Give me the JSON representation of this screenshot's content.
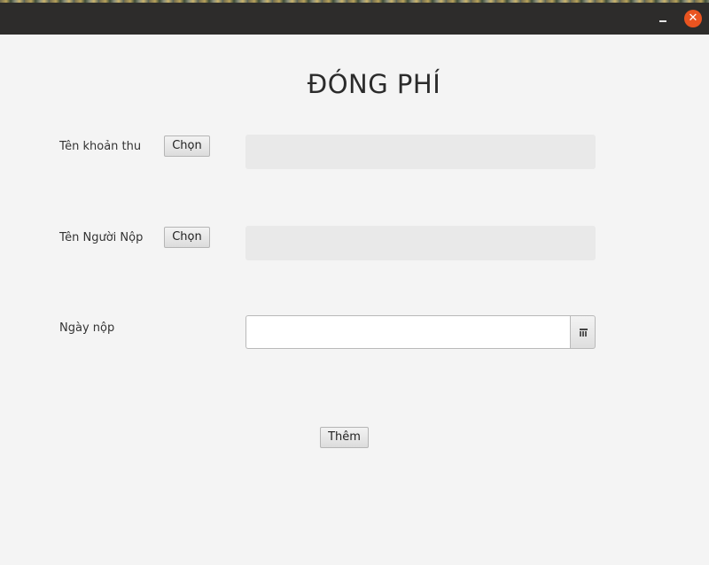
{
  "window": {
    "minimize_label": "–",
    "close_label": "✕",
    "close_color": "#e95420",
    "titlebar_color": "#2d2c2b"
  },
  "form": {
    "title": "ĐÓNG PHÍ",
    "fee_name": {
      "label": "Tên khoản thu",
      "button_label": "Chọn",
      "value": ""
    },
    "payer_name": {
      "label": "Tên Người Nộp",
      "button_label": "Chọn",
      "value": ""
    },
    "payment_date": {
      "label": "Ngày nộp",
      "value": "",
      "picker_icon": "calendar-icon"
    },
    "submit_label": "Thêm"
  }
}
